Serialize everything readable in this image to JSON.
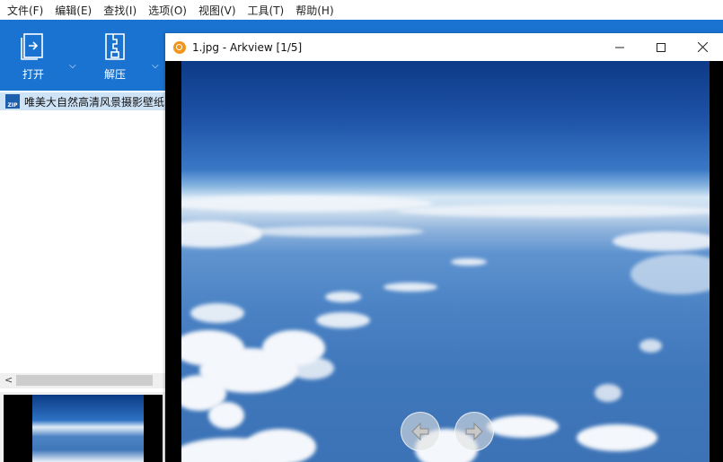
{
  "menubar": {
    "items": [
      "文件(F)",
      "编辑(E)",
      "查找(I)",
      "选项(O)",
      "视图(V)",
      "工具(T)",
      "帮助(H)"
    ]
  },
  "toolbar": {
    "open_label": "打开",
    "extract_label": "解压",
    "background_color": "#1a73d1"
  },
  "file_list": {
    "items": [
      {
        "icon": "zip-archive-icon",
        "icon_text": "ZIP",
        "name": "唯美大自然高清风景摄影壁纸"
      }
    ]
  },
  "viewer": {
    "title": "1.jpg - Arkview [1/5]",
    "icon": "arkview-magnifier-icon",
    "controls": [
      "minimize-icon",
      "maximize-icon",
      "close-icon"
    ],
    "nav": [
      "previous-arrow-icon",
      "next-arrow-icon"
    ]
  },
  "colors": {
    "accent": "#1a73d1",
    "selection": "#cfe3f7",
    "app_icon": "#f0961c"
  }
}
